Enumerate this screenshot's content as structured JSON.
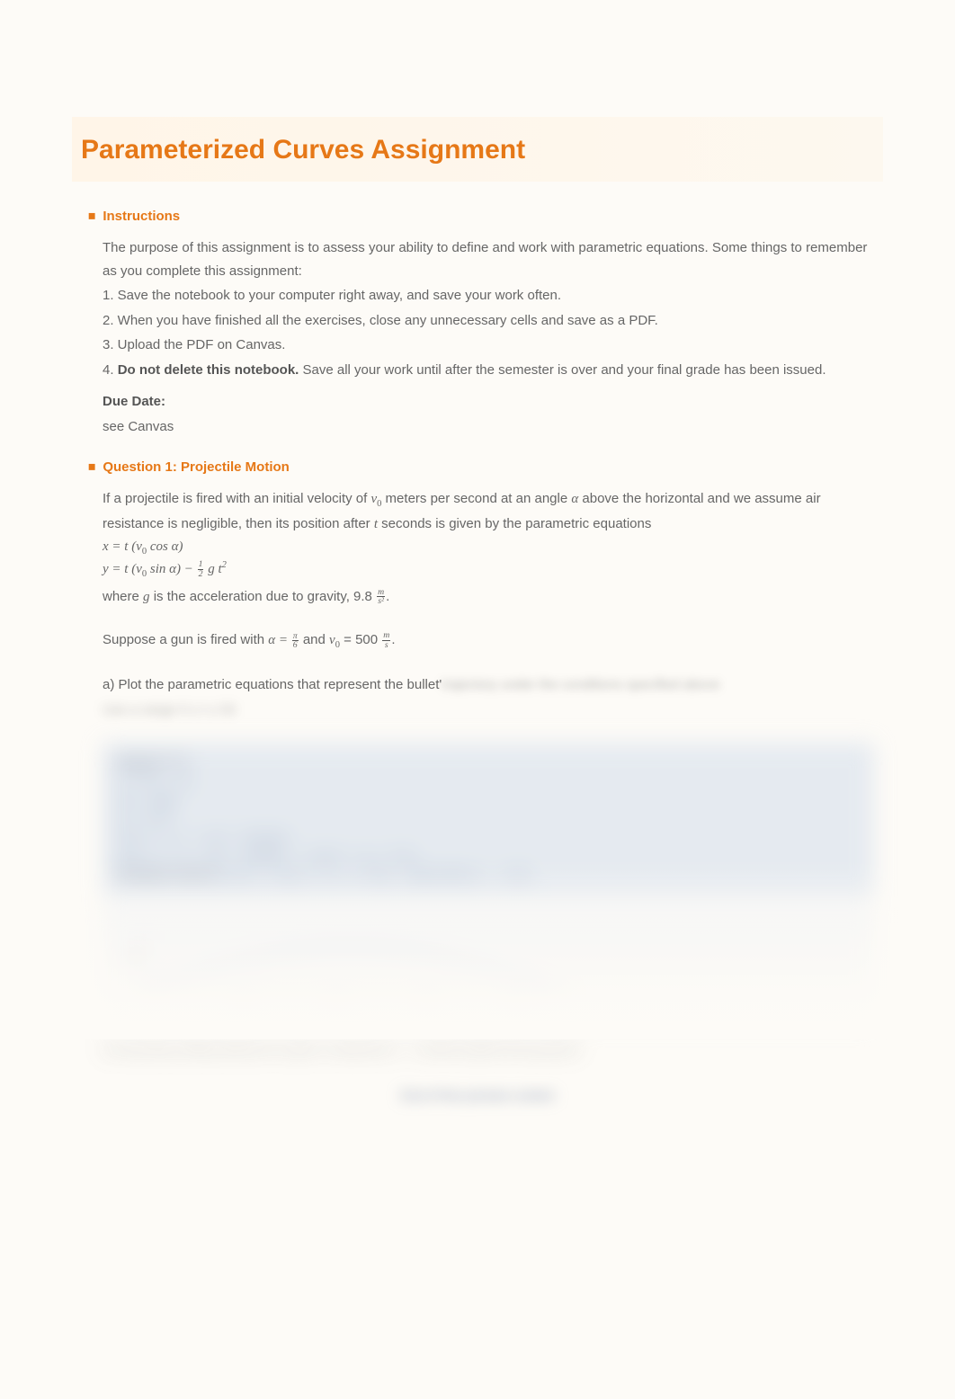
{
  "title": "Parameterized Curves Assignment",
  "instructions": {
    "header": "Instructions",
    "intro": "The purpose of this assignment is to assess your ability to define and work with parametric equations. Some things to remember as you complete this assignment:",
    "items": [
      "1. Save the notebook to your computer right away, and save your work often.",
      "2. When you have finished all the exercises, close any unnecessary cells and save as a PDF.",
      "3. Upload the PDF on Canvas."
    ],
    "item4_prefix": "4. ",
    "item4_bold": "Do not delete this notebook.",
    "item4_rest": " Save all your work until after the semester is over and your final grade has been issued.",
    "due_label": "Due Date:",
    "due_value": "see Canvas"
  },
  "question1": {
    "header": "Question 1:  Projectile Motion",
    "p1_a": "If a projectile is fired with an initial velocity of ",
    "p1_b": " meters per second at an angle ",
    "p1_c": " above the horizontal and we assume air resistance is negligible, then its position after ",
    "p1_d": " seconds is given by the parametric equations",
    "eq_x_pre": "x = t (v",
    "eq_x_post": " cos α)",
    "eq_y_pre": "y = t (v",
    "eq_y_mid": " sin α) − ",
    "eq_y_post": " g t",
    "where_a": "where ",
    "where_b": " is the acceleration due to gravity, 9.8 ",
    "where_c": ".",
    "suppose_a": "Suppose a gun is fired with ",
    "suppose_b": " and ",
    "suppose_c": " = 500 ",
    "suppose_d": ".",
    "part_a": "a) Plot the parametric equations that represent the bullet'",
    "blur_trail": "trajectory under the conditions specified above",
    "blur_trail2": "Use a range 0 ≤ t ≤ 50"
  },
  "code": {
    "l1": "Clear[\"*\"]",
    "l2": "α = Pi / 6;",
    "l3": "v0 = 500;",
    "l4": "g = 9.8;",
    "l5": "x[t_] := t * v0 * Cos[α];",
    "l6": "y[t_] := t * v0 * Sin[α] - (1/2) * g * t^2;",
    "l7_a": "ParametricPlot",
    "l7_b": "[{x[t], y[t]}, {t, 0, 50}, AspectRatio → 1/5]"
  },
  "blur_caption": "b) Assuming nothing obstructs its path, at what time t = ? will the bullet hit the ground?",
  "footer": "End of free preview content",
  "vars": {
    "v0": "v",
    "v0_sub": "0",
    "alpha": "α",
    "t": "t",
    "g": "g",
    "pi": "π",
    "six": "6",
    "one": "1",
    "two": "2",
    "m": "m",
    "s": "s",
    "s2": "s²",
    "sq": "2"
  }
}
